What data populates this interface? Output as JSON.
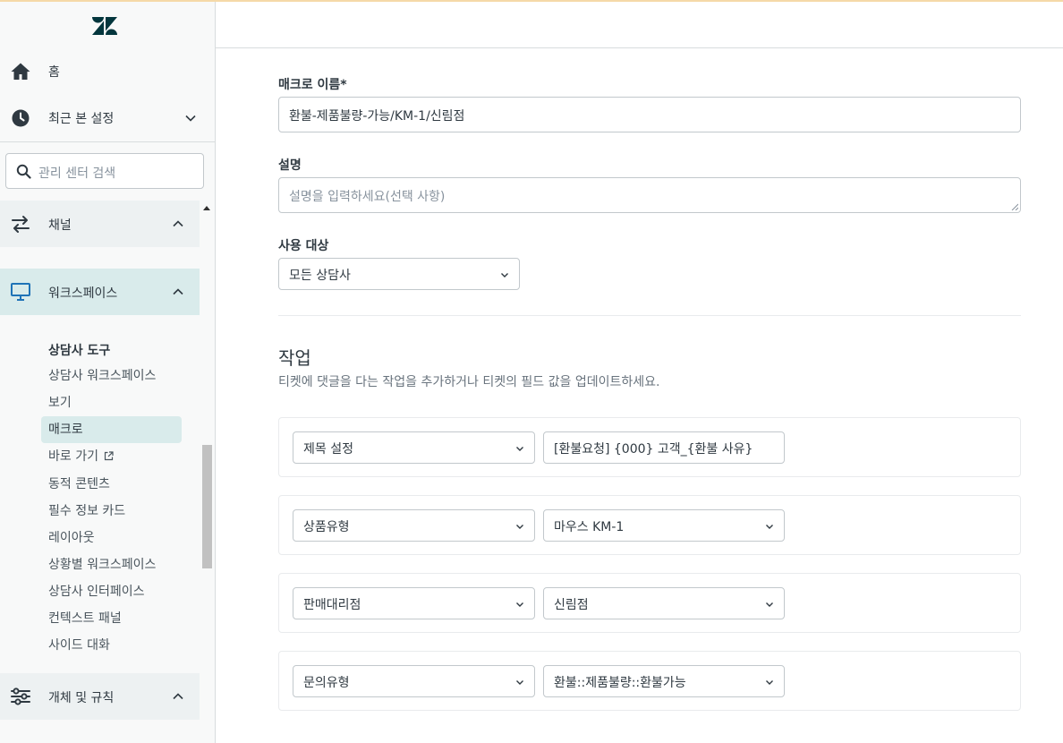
{
  "sidebar": {
    "home_label": "홈",
    "recent_label": "최근 본 설정",
    "search_placeholder": "관리 센터 검색",
    "sections": {
      "channels": "채널",
      "workspaces": "워크스페이스",
      "objects": "개체 및 규칙"
    },
    "workspace_group_heading": "상담사 도구",
    "workspace_items": [
      "상담사 워크스페이스",
      "보기",
      "매크로",
      "바로 가기",
      "동적 콘텐츠",
      "필수 정보 카드",
      "레이아웃",
      "상황별 워크스페이스",
      "상담사 인터페이스",
      "컨텍스트 패널",
      "사이드 대화"
    ]
  },
  "form": {
    "name_label": "매크로 이름*",
    "name_value": "환불-제품불량-가능/KM-1/신림점",
    "desc_label": "설명",
    "desc_placeholder": "설명을 입력하세요(선택 사항)",
    "avail_label": "사용 대상",
    "avail_value": "모든 상담사"
  },
  "actions": {
    "title": "작업",
    "description": "티켓에 댓글을 다는 작업을 추가하거나 티켓의 필드 값을 업데이트하세요.",
    "rows": [
      {
        "field": "제목 설정",
        "value": "[환불요청] {000} 고객_{환불 사유}"
      },
      {
        "field": "상품유형",
        "value": "마우스 KM-1"
      },
      {
        "field": "판매대리점",
        "value": "신림점"
      },
      {
        "field": "문의유형",
        "value": "환불::제품불량::환불가능"
      }
    ]
  },
  "colors": {
    "brand": "#03363d",
    "active_bg": "#d9ebeb",
    "border": "#c2c8cc"
  }
}
